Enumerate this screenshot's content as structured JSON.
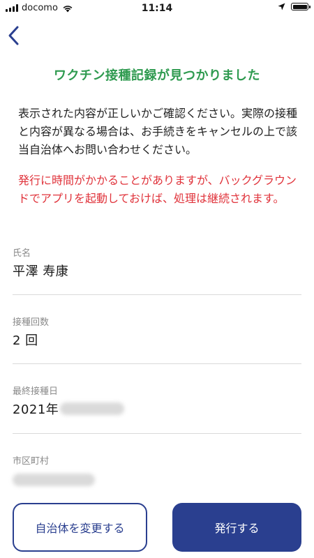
{
  "status_bar": {
    "carrier": "docomo",
    "time": "11:14",
    "icons": [
      "signal-icon",
      "wifi-icon",
      "location-arrow-icon",
      "battery-icon"
    ]
  },
  "header": {
    "back_icon": "chevron-left-icon"
  },
  "main": {
    "title": "ワクチン接種記録が見つかりました",
    "description": "表示された内容が正しいかご確認ください。実際の接種と内容が異なる場合は、お手続きをキャンセルの上で該当自治体へお問い合わせください。",
    "warning": "発行に時間がかかることがありますが、バックグラウンドでアプリを起動しておけば、処理は継続されます。"
  },
  "fields": {
    "name": {
      "label": "氏名",
      "value": "平澤 寿康"
    },
    "dose_count": {
      "label": "接種回数",
      "value": "2 回"
    },
    "last_date": {
      "label": "最終接種日",
      "value": "2021年"
    },
    "municipality": {
      "label": "市区町村"
    }
  },
  "buttons": {
    "change_municipality": "自治体を変更する",
    "issue": "発行する"
  },
  "colors": {
    "title_green": "#2e9a4f",
    "warning_red": "#e0333b",
    "primary_blue": "#2a3f8f",
    "label_gray": "#8a8a8a"
  }
}
